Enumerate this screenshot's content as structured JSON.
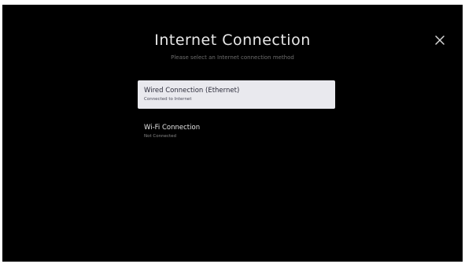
{
  "header": {
    "title": "Internet Connection",
    "subtitle": "Please select an Internet connection method"
  },
  "close_icon": "close-x-icon",
  "options": [
    {
      "label": "Wired Connection (Ethernet)",
      "status": "Connected to Internet",
      "selected": true
    },
    {
      "label": "Wi-Fi Connection",
      "status": "Not Connected",
      "selected": false
    }
  ],
  "colors": {
    "background": "#000000",
    "selected_bg": "#e9e9ee",
    "title": "#e8e8e8"
  }
}
